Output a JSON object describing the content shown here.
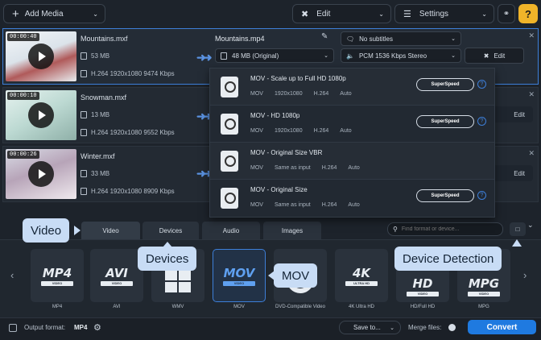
{
  "toolbar": {
    "add_media": "Add Media",
    "edit": "Edit",
    "settings": "Settings"
  },
  "files": [
    {
      "time": "00:00:40",
      "name": "Mountains.mxf",
      "size": "53 MB",
      "codec": "H.264 1920x1080 9474 Kbps",
      "output_name": "Mountains.mp4",
      "output_size": "48 MB (Original)",
      "subtitles": "No subtitles",
      "audio": "PCM 1536 Kbps Stereo",
      "edit": "Edit"
    },
    {
      "time": "00:00:10",
      "name": "Snowman.mxf",
      "size": "13 MB",
      "codec": "H.264 1920x1080 9552 Kbps",
      "edit": "Edit"
    },
    {
      "time": "00:00:26",
      "name": "Winter.mxf",
      "size": "33 MB",
      "codec": "H.264 1920x1080 8909 Kbps",
      "edit": "Edit"
    }
  ],
  "presets": [
    {
      "title": "MOV - Scale up to Full HD 1080p",
      "format": "MOV",
      "res": "1920x1080",
      "codec": "H.264",
      "bitrate": "Auto",
      "superspeed": "SuperSpeed"
    },
    {
      "title": "MOV - HD 1080p",
      "format": "MOV",
      "res": "1920x1080",
      "codec": "H.264",
      "bitrate": "Auto",
      "superspeed": "SuperSpeed"
    },
    {
      "title": "MOV - Original Size VBR",
      "format": "MOV",
      "res": "Same as input",
      "codec": "H.264",
      "bitrate": "Auto"
    },
    {
      "title": "MOV - Original Size",
      "format": "MOV",
      "res": "Same as input",
      "codec": "H.264",
      "bitrate": "Auto",
      "superspeed": "SuperSpeed"
    }
  ],
  "tabs": [
    "Video",
    "Devices",
    "Audio",
    "Images"
  ],
  "search": {
    "placeholder": "Find format or device..."
  },
  "formats": [
    {
      "big": "MP4",
      "sub": "VIDEO",
      "label": "MP4"
    },
    {
      "big": "AVI",
      "sub": "VIDEO",
      "label": "AVI"
    },
    {
      "big": "",
      "sub": "",
      "label": "WMV"
    },
    {
      "big": "MOV",
      "sub": "VIDEO",
      "label": "MOV"
    },
    {
      "big": "",
      "sub": "",
      "label": "DVD-Compatible Video"
    },
    {
      "big": "4K",
      "sub": "ULTRA HD",
      "label": "4K Ultra HD"
    },
    {
      "big": "HD",
      "sub": "VIDEO",
      "label": "HD/Full HD"
    },
    {
      "big": "MPG",
      "sub": "VIDEO",
      "label": "MPG"
    }
  ],
  "callouts": {
    "video": "Video",
    "devices": "Devices",
    "mov": "MOV",
    "device_detection": "Device Detection"
  },
  "bottom": {
    "output_label": "Output format:",
    "output_value": "MP4",
    "save_to": "Save to...",
    "merge_files": "Merge files:",
    "convert": "Convert"
  },
  "colors": {
    "accent": "#1f7ae0",
    "callout": "#c8dcf5"
  }
}
